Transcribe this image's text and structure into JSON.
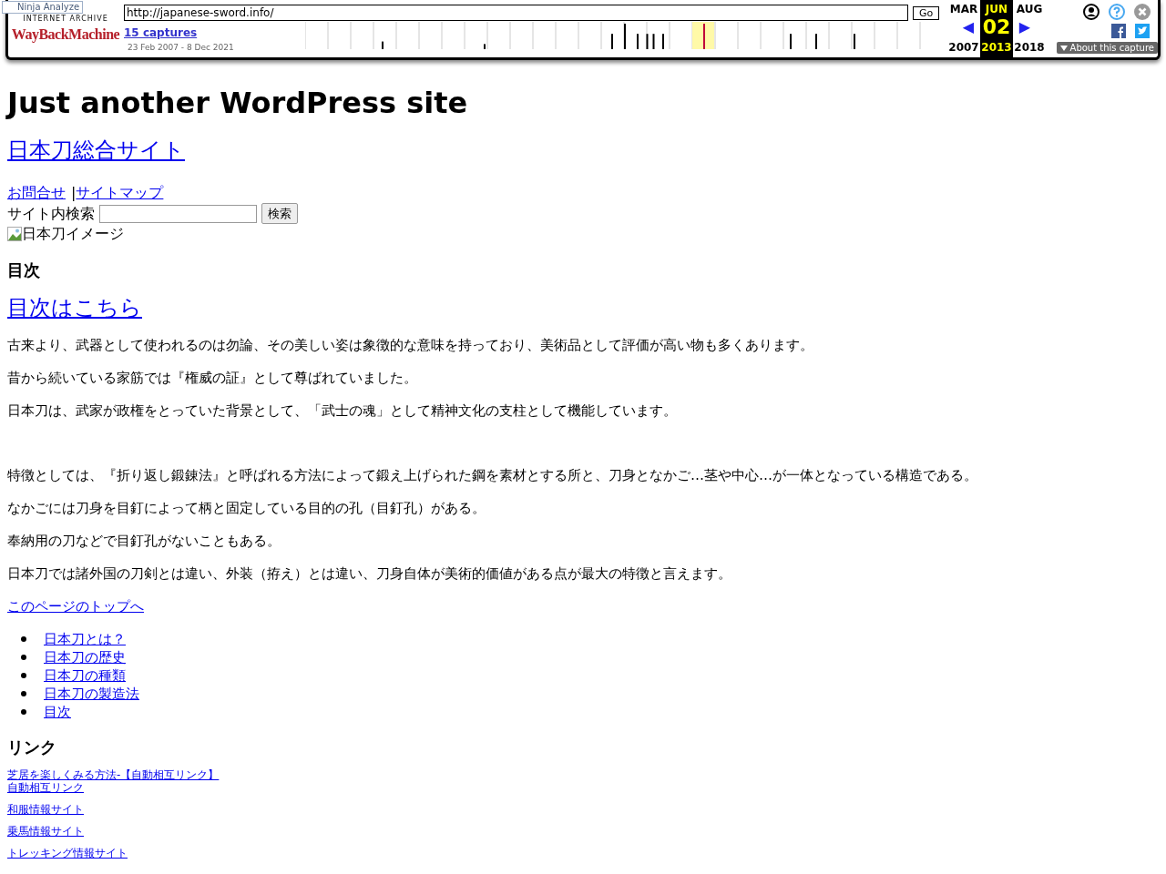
{
  "toolbar": {
    "badge": "Ninja Analyze",
    "logo_top": "INTERNET ARCHIVE",
    "logo": "WayBackMachine",
    "url": "http://japanese-sword.info/",
    "go": "Go",
    "captures": "15 captures",
    "range": "23 Feb 2007 - 8 Dec 2021",
    "months": [
      {
        "month": "MAR",
        "arrow": "◀",
        "year": "2007",
        "selected": false
      },
      {
        "month": "JUN",
        "day": "02",
        "year": "2013",
        "selected": true
      },
      {
        "month": "AUG",
        "arrow": "▶",
        "year": "2018",
        "selected": false
      }
    ],
    "about": "About this capture"
  },
  "site_title": "Just another WordPress site",
  "site_name": "日本刀総合サイト",
  "top_links": [
    "お問合せ",
    "サイトマップ"
  ],
  "separator": "|",
  "search": {
    "label": "サイト内検索",
    "button": "検索"
  },
  "image_alt": "日本刀イメージ",
  "toc_heading": "目次",
  "toc_link": "目次はこちら",
  "paragraphs": [
    "古来より、武器として使われるのは勿論、その美しい姿は象徴的な意味を持っており、美術品として評価が高い物も多くあります。",
    "昔から続いている家筋では『権威の証』として尊ばれていました。",
    "日本刀は、武家が政権をとっていた背景として、「武士の魂」として精神文化の支柱として機能しています。"
  ],
  "paragraphs_2": [
    "特徴としては、『折り返し鍛錬法』と呼ばれる方法によって鍛え上げられた鋼を素材とする所と、刀身となかご…茎や中心…が一体となっている構造である。",
    "なかごには刀身を目釘によって柄と固定している目的の孔（目釘孔）がある。",
    "奉納用の刀などで目釘孔がないこともある。",
    "日本刀では諸外国の刀剣とは違い、外装（拵え）とは違い、刀身自体が美術的価値がある点が最大の特徴と言えます。"
  ],
  "top_link": "このページのトップへ",
  "nav": [
    "日本刀とは？",
    "日本刀の歴史",
    "日本刀の種類",
    "日本刀の製造法",
    "目次"
  ],
  "links_heading": "リンク",
  "links": [
    [
      "芝居を楽しくみる方法-【自動相互リンク】",
      "自動相互リンク"
    ],
    [
      "和服情報サイト"
    ],
    [
      "乗馬情報サイト"
    ],
    [
      "トレッキング情報サイト"
    ]
  ]
}
